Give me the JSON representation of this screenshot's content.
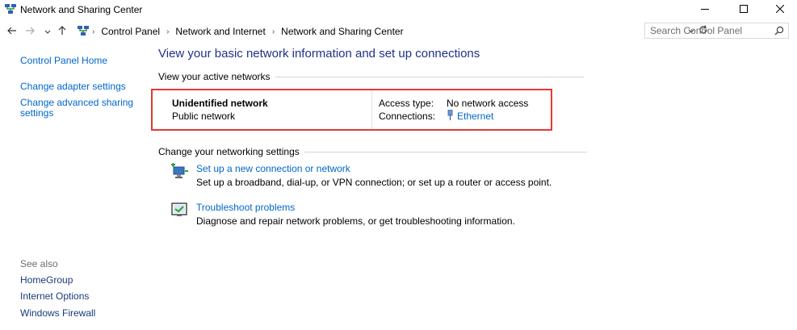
{
  "window": {
    "title": "Network and Sharing Center",
    "app_icon": "network-center-icon",
    "controls": [
      "minimize-icon",
      "maximize-icon",
      "close-icon"
    ]
  },
  "nav": {
    "back_icon": "arrow-left-icon",
    "forward_icon": "arrow-right-icon",
    "recent_icon": "chevron-down-icon",
    "up_icon": "arrow-up-icon"
  },
  "address": {
    "breadcrumbs": [
      "Control Panel",
      "Network and Internet",
      "Network and Sharing Center"
    ],
    "dropdown_icon": "chevron-down-icon",
    "refresh_icon": "refresh-icon"
  },
  "search": {
    "placeholder": "Search Control Panel",
    "icon": "search-icon"
  },
  "sidebar": {
    "items": [
      {
        "label": "Control Panel Home"
      },
      {
        "label": "Change adapter settings"
      },
      {
        "label": "Change advanced sharing settings",
        "line1": "Change advanced sharing",
        "line2": "settings"
      }
    ],
    "see_also_label": "See also",
    "see_also": [
      {
        "label": "HomeGroup"
      },
      {
        "label": "Internet Options"
      },
      {
        "label": "Windows Firewall"
      }
    ]
  },
  "main": {
    "heading": "View your basic network information and set up connections",
    "active_networks_label": "View your active networks",
    "network": {
      "name": "Unidentified network",
      "category": "Public network",
      "access_type_label": "Access type:",
      "access_type_value": "No network access",
      "connections_label": "Connections:",
      "connection_icon": "ethernet-icon",
      "connection_value": "Ethernet"
    },
    "change_settings_label": "Change your networking settings",
    "tasks": [
      {
        "icon": "new-connection-icon",
        "link": "Set up a new connection or network",
        "description": "Set up a broadband, dial-up, or VPN connection; or set up a router or access point."
      },
      {
        "icon": "troubleshoot-icon",
        "link": "Troubleshoot problems",
        "description": "Diagnose and repair network problems, or get troubleshooting information."
      }
    ]
  },
  "colors": {
    "link": "#0066cc",
    "heading": "#1e3287",
    "highlight_border": "#e53935",
    "muted": "#6d6d6d"
  }
}
